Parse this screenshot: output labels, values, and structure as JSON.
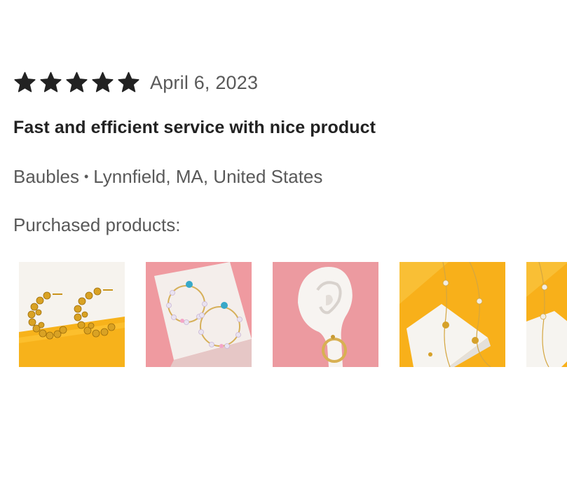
{
  "review": {
    "rating": 5,
    "rating_max": 5,
    "star_color": "#222222",
    "date": "April 6, 2023",
    "headline": "Fast and efficient service with nice product",
    "shop": "Baubles",
    "separator": "•",
    "location": "Lynnfield, MA, United States",
    "purchased_label": "Purchased products:"
  },
  "products": [
    {
      "icon": "gold-beaded-hoop-earrings-image",
      "bg": "#f7b21b"
    },
    {
      "icon": "crystal-hoop-earrings-image",
      "bg": "#ef9aa0"
    },
    {
      "icon": "earring-on-ear-model-image",
      "bg": "#ec9aa0"
    },
    {
      "icon": "gold-bead-chain-image",
      "bg": "#f8b01a"
    },
    {
      "icon": "pearl-chain-image",
      "bg": "#f8b01a"
    }
  ]
}
